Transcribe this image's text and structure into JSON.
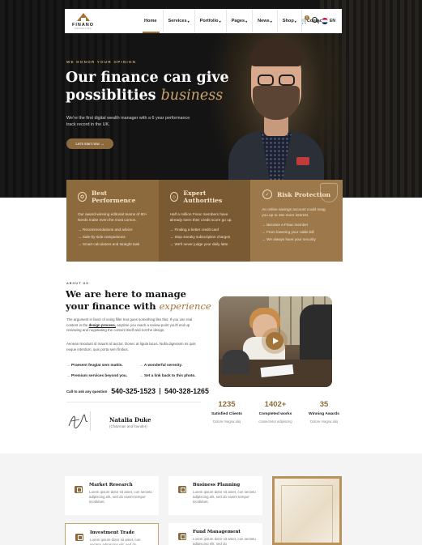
{
  "brand": {
    "name": "FINANO",
    "tagline": "CONSULTING"
  },
  "nav": {
    "items": [
      {
        "label": "Home",
        "caret": ""
      },
      {
        "label": "Services",
        "caret": "▾"
      },
      {
        "label": "Portfolio",
        "caret": "▾"
      },
      {
        "label": "Pages",
        "caret": "▾"
      },
      {
        "label": "News",
        "caret": "▾"
      },
      {
        "label": "Shop",
        "caret": "▾"
      },
      {
        "label": "Contact",
        "caret": ""
      }
    ],
    "cart_count": "0",
    "language": "EN"
  },
  "hero": {
    "eyebrow": "WE HONOR YOUR OPINION",
    "title_main": "Our finance can give possiblities ",
    "title_accent": "business",
    "description": "We're the first digital wealth manager with a 6 year performance track record in the UK.",
    "cta": "Let's start now →"
  },
  "features": [
    {
      "icon": "medal-icon",
      "title": "Best Performence",
      "desc": "Our award-winning editorial teams of 80+ Nerds make even the most comon.",
      "items": [
        "Recommendations and advice",
        "Side-by-side comparisons",
        "Smart calculators and straight task"
      ]
    },
    {
      "icon": "diamond-icon",
      "title": "Expert Authorities",
      "desc": "Half a million Finac members have already seen their credit score go up.",
      "items": [
        "Finding a better credit card",
        "Stop sneaky subscription charges",
        "We'll never judge your daily latte"
      ]
    },
    {
      "icon": "shield-check-icon",
      "title": "Risk Protection",
      "desc": "An online savings account could snag you up to 15x more interest.",
      "items": [
        "Become a Finac member",
        "From lowering your cable bill",
        "We always have your security"
      ]
    }
  ],
  "about": {
    "eyebrow": "ABOUT US",
    "title_main": "We are here to manage your finance with ",
    "title_accent": "experience",
    "para1_a": "The argument in favor of using filler text goes something like this: If you use real content in the ",
    "para1_link": "design process,",
    "para1_b": " anytime you reach a review point you'll end up reviewing and negotiating the content itself and not the design.",
    "para2": "Aenean tincidunt id mauris id auctor. Donec at ligula lacus. Nulla dignissim mi quis neque interdum, quis porta sem finibus.",
    "checks": [
      "Praesent feugiat sem mattis.",
      "A wonderful serenity.",
      "Premium services beyond you.",
      "Set a link back to this photo."
    ],
    "phone_question": "Call to ask any question",
    "phone1": "540-325-1523",
    "phone2": "540-328-1265",
    "ceo_name": "Natalia Duke",
    "ceo_role": "(Chairman and founder)"
  },
  "stats": [
    {
      "value": "1235",
      "label": "Satisfied Clients",
      "sub": "Dolore magna aliq"
    },
    {
      "value": "1402+",
      "label": "Completed works",
      "sub": "consectetur adipiscing"
    },
    {
      "value": "35",
      "label": "Winning Awards",
      "sub": "Dolore magna aliq"
    }
  ],
  "services": [
    {
      "title": "Market Research",
      "desc": "Lorem ipsum dolor sit amet, con sectetu adipiscing elit, sed do eiusm tempor incididunt."
    },
    {
      "title": "Business Planning",
      "desc": "Lorem ipsum dolor sit amet, con sectetu adipiscing elit, sed do eiusm tempor incididunt."
    },
    {
      "title": "Investment Trade",
      "desc": "Lorem ipsum dolor sit amet, con sectetu adipiscing elit, sed do"
    },
    {
      "title": "Fund Management",
      "desc": "Lorem ipsum dolor sit amet, con sectetu adipiscing elit, sed do"
    }
  ],
  "colors": {
    "accent": "#a2743a",
    "gold": "#c9a46b",
    "dark": "#141414"
  }
}
